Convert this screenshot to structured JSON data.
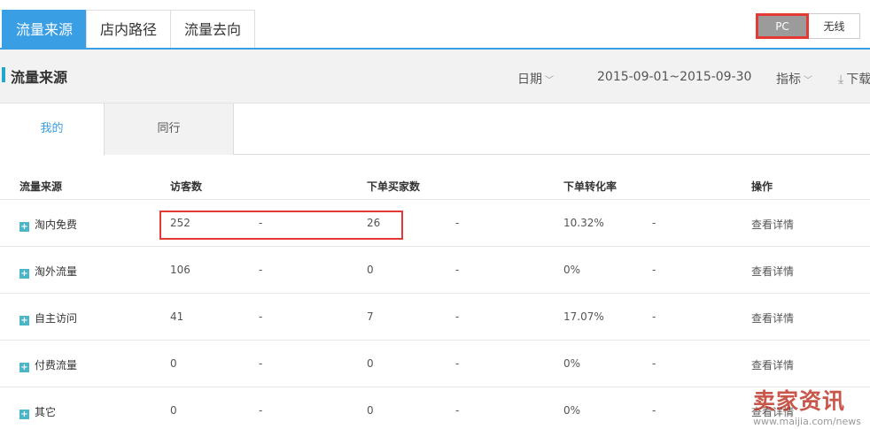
{
  "top_tabs": [
    {
      "label": "流量来源"
    },
    {
      "label": "店内路径"
    },
    {
      "label": "流量去向"
    }
  ],
  "device_toggle": {
    "pc": "PC",
    "wireless": "无线"
  },
  "section": {
    "title": "流量来源",
    "date_label": "日期",
    "date_range": "2015-09-01~2015-09-30",
    "metric_label": "指标",
    "download_label": "下载"
  },
  "sub_tabs": [
    {
      "label": "我的"
    },
    {
      "label": "同行"
    }
  ],
  "table": {
    "headers": {
      "source": "流量来源",
      "visitors": "访客数",
      "buyers": "下单买家数",
      "rate": "下单转化率",
      "action": "操作"
    },
    "rows": [
      {
        "source": "淘内免费",
        "visitors": "252",
        "d1": "-",
        "buyers": "26",
        "d2": "-",
        "rate": "10.32%",
        "d3": "-",
        "action": "查看详情"
      },
      {
        "source": "淘外流量",
        "visitors": "106",
        "d1": "-",
        "buyers": "0",
        "d2": "-",
        "rate": "0%",
        "d3": "-",
        "action": "查看详情"
      },
      {
        "source": "自主访问",
        "visitors": "41",
        "d1": "-",
        "buyers": "7",
        "d2": "-",
        "rate": "17.07%",
        "d3": "-",
        "action": "查看详情"
      },
      {
        "source": "付费流量",
        "visitors": "0",
        "d1": "-",
        "buyers": "0",
        "d2": "-",
        "rate": "0%",
        "d3": "-",
        "action": "查看详情"
      },
      {
        "source": "其它",
        "visitors": "0",
        "d1": "-",
        "buyers": "0",
        "d2": "-",
        "rate": "0%",
        "d3": "-",
        "action": "查看详情"
      }
    ]
  },
  "watermark": {
    "text": "卖家资讯",
    "url": "www.maijia.com/news"
  }
}
